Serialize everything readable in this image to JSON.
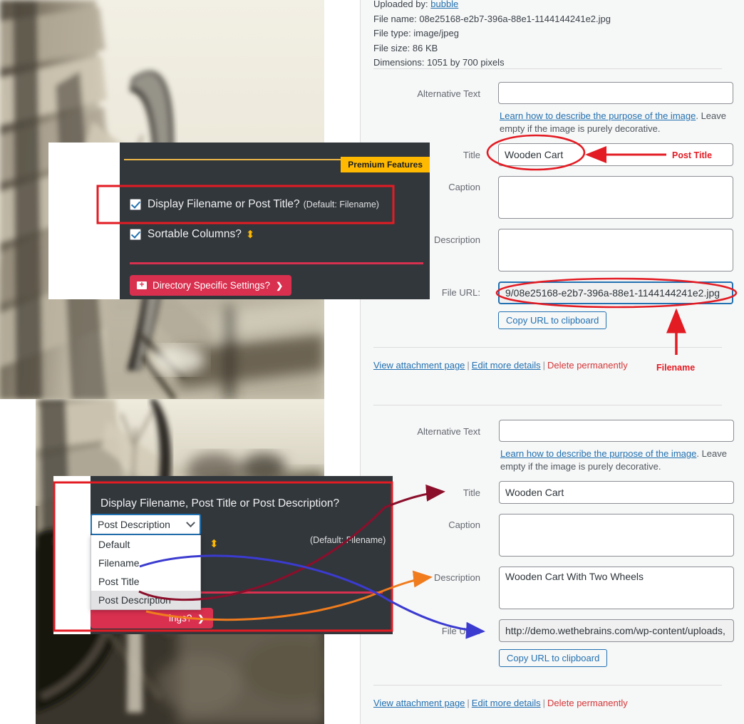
{
  "attachment_top": {
    "meta": {
      "uploaded_by_label": "Uploaded by:",
      "uploaded_by_value": "bubble",
      "file_name_label": "File name:",
      "file_name_value": "08e25168-e2b7-396a-88e1-1144144241e2.jpg",
      "file_type_label": "File type:",
      "file_type_value": "image/jpeg",
      "file_size_label": "File size:",
      "file_size_value": "86 KB",
      "dimensions_label": "Dimensions:",
      "dimensions_value": "1051 by 700 pixels"
    },
    "alt_text_label": "Alternative Text",
    "alt_text_value": "",
    "alt_help_link": "Learn how to describe the purpose of the image",
    "alt_help_rest": ". Leave empty if the image is purely decorative.",
    "title_label": "Title",
    "title_value": "Wooden Cart",
    "caption_label": "Caption",
    "caption_value": "",
    "description_label": "Description",
    "description_value": "",
    "file_url_label": "File URL:",
    "file_url_value": "9/08e25168-e2b7-396a-88e1-1144144241e2.jpg",
    "copy_url_button": "Copy URL to clipboard",
    "action_view": "View attachment page",
    "action_edit": "Edit more details",
    "action_delete": "Delete permanently"
  },
  "attachment_bottom": {
    "alt_text_label": "Alternative Text",
    "alt_text_value": "",
    "alt_help_link": "Learn how to describe the purpose of the image",
    "alt_help_rest": ". Leave empty if the image is purely decorative.",
    "title_label": "Title",
    "title_value": "Wooden Cart",
    "caption_label": "Caption",
    "caption_value": "",
    "description_label": "Description",
    "description_value": "Wooden Cart With Two Wheels",
    "file_url_label": "File URL:",
    "file_url_value": "http://demo.wethebrains.com/wp-content/uploads,",
    "copy_url_button": "Copy URL to clipboard",
    "action_view": "View attachment page",
    "action_edit": "Edit more details",
    "action_delete": "Delete permanently"
  },
  "panel_top": {
    "premium_badge": "Premium Features",
    "option_display": "Display Filename or Post Title?",
    "option_display_default": "(Default: Filename)",
    "option_sortable": "Sortable Columns?",
    "sort_glyph": "⬍",
    "directory_button": "Directory Specific Settings?",
    "directory_chevron": "❯"
  },
  "panel_bottom": {
    "dropdown_title": "Display Filename, Post Title or Post Description?",
    "dropdown_value": "Post Description",
    "dropdown_options": [
      "Default",
      "Filename",
      "Post Title",
      "Post Description"
    ],
    "dropdown_selected_index": 3,
    "option_default_note": "(Default: Filename)",
    "sort_glyph": "⬍",
    "directory_button_partial": "ings?",
    "directory_chevron": "❯"
  },
  "annotations": {
    "post_title": "Post Title",
    "filename": "Filename"
  },
  "colors": {
    "annotation_red": "#e31b23",
    "panel_dark": "#32373c",
    "premium_gold": "#ffb900",
    "crimson": "#d9304f",
    "link_blue": "#2271b1",
    "arrow_darkred": "#8b0f2b",
    "arrow_orange": "#f07c1e",
    "arrow_blue": "#3b3bd0"
  }
}
